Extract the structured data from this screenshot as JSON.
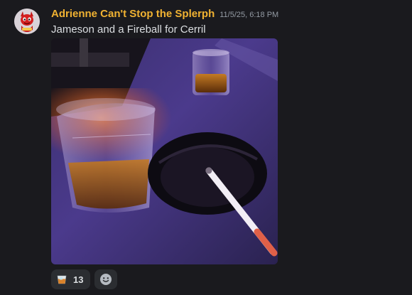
{
  "message": {
    "author": "Adrienne Can't Stop the Splerph",
    "timestamp": "11/5/25, 6:18 PM",
    "text": "Jameson and a Fireball for Cerril",
    "author_color": "#f0b232"
  },
  "attachment": {
    "type": "image",
    "alt": "photo attachment"
  },
  "reactions": [
    {
      "emoji": "tumbler-glass-icon",
      "count": "13"
    }
  ],
  "add_reaction": {
    "icon": "add-reaction-icon"
  }
}
